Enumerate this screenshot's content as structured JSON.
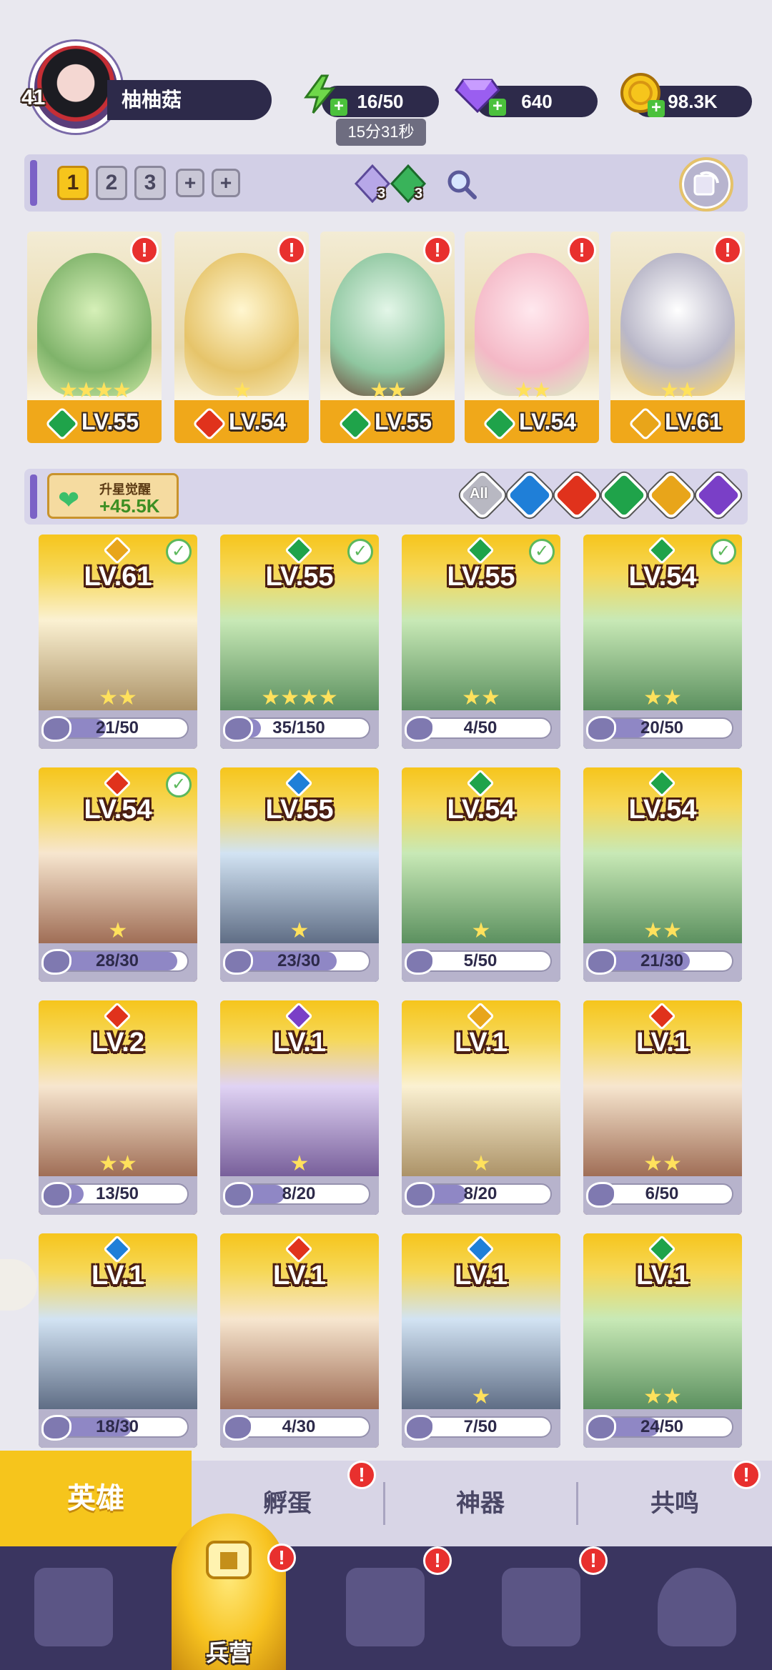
{
  "player": {
    "level": "41",
    "name": "柚柚菇"
  },
  "resources": {
    "energy": "16/50",
    "energy_timer": "15分31秒",
    "gems": "640",
    "coins": "98.3K"
  },
  "formation": {
    "slots": [
      "1",
      "2",
      "3"
    ],
    "gem_count_1": "3",
    "gem_count_2": "3"
  },
  "team": [
    {
      "level": "LV.55",
      "element": "wind"
    },
    {
      "level": "LV.54",
      "element": "fire"
    },
    {
      "level": "LV.55",
      "element": "wind"
    },
    {
      "level": "LV.54",
      "element": "wind"
    },
    {
      "level": "LV.61",
      "element": "light"
    }
  ],
  "awaken": {
    "title": "升星觉醒",
    "value": "+45.5K"
  },
  "filter": {
    "all_label": "All"
  },
  "heroes": [
    {
      "level": "LV.61",
      "element": "light",
      "progress": "21/50",
      "fraction": 0.42,
      "check": true,
      "stars": "★★"
    },
    {
      "level": "LV.55",
      "element": "wind",
      "progress": "35/150",
      "fraction": 0.23,
      "check": true,
      "stars": "★★★★"
    },
    {
      "level": "LV.55",
      "element": "wind",
      "progress": "4/50",
      "fraction": 0.08,
      "check": true,
      "stars": "★★"
    },
    {
      "level": "LV.54",
      "element": "wind",
      "progress": "20/50",
      "fraction": 0.4,
      "check": true,
      "stars": "★★"
    },
    {
      "level": "LV.54",
      "element": "fire",
      "progress": "28/30",
      "fraction": 0.93,
      "check": true,
      "stars": "★"
    },
    {
      "level": "LV.55",
      "element": "water",
      "progress": "23/30",
      "fraction": 0.77,
      "check": false,
      "stars": "★"
    },
    {
      "level": "LV.54",
      "element": "wind",
      "progress": "5/50",
      "fraction": 0.1,
      "check": false,
      "stars": "★"
    },
    {
      "level": "LV.54",
      "element": "wind",
      "progress": "21/30",
      "fraction": 0.7,
      "check": false,
      "stars": "★★"
    },
    {
      "level": "LV.2",
      "element": "fire",
      "progress": "13/50",
      "fraction": 0.26,
      "check": false,
      "stars": "★★"
    },
    {
      "level": "LV.1",
      "element": "dark",
      "progress": "8/20",
      "fraction": 0.4,
      "check": false,
      "stars": "★"
    },
    {
      "level": "LV.1",
      "element": "light",
      "progress": "8/20",
      "fraction": 0.4,
      "check": false,
      "stars": "★"
    },
    {
      "level": "LV.1",
      "element": "fire",
      "progress": "6/50",
      "fraction": 0.12,
      "check": false,
      "stars": "★★"
    },
    {
      "level": "LV.1",
      "element": "water",
      "progress": "18/30",
      "fraction": 0.6,
      "check": false,
      "stars": ""
    },
    {
      "level": "LV.1",
      "element": "fire",
      "progress": "4/30",
      "fraction": 0.13,
      "check": false,
      "stars": ""
    },
    {
      "level": "LV.1",
      "element": "water",
      "progress": "7/50",
      "fraction": 0.14,
      "check": false,
      "stars": "★"
    },
    {
      "level": "LV.1",
      "element": "wind",
      "progress": "24/50",
      "fraction": 0.48,
      "check": false,
      "stars": "★★"
    }
  ],
  "tabs": [
    "英雄",
    "孵蛋",
    "神器",
    "共鸣"
  ],
  "nav": {
    "selected_label": "兵营"
  },
  "colors": {
    "wind": "#1fa34a",
    "fire": "#e0321c",
    "water": "#1f7fd8",
    "light": "#e8a51a",
    "dark": "#7a3fc7",
    "accent": "#f6c51c"
  }
}
